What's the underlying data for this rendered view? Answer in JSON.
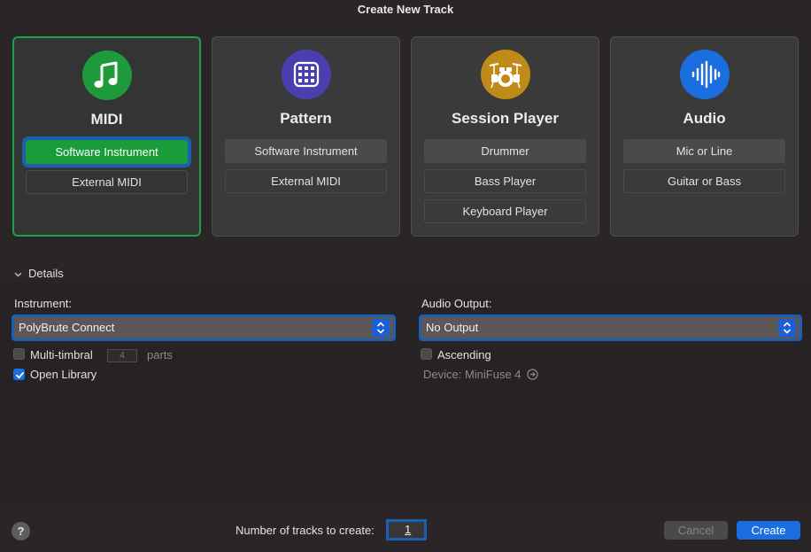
{
  "window": {
    "title": "Create New Track"
  },
  "track_types": [
    {
      "title": "MIDI",
      "icon": "music-note-icon",
      "color": "#1f9a3a",
      "selected": true,
      "options": [
        "Software Instrument",
        "External MIDI"
      ]
    },
    {
      "title": "Pattern",
      "icon": "grid-icon",
      "color": "#4b3fb0",
      "selected": false,
      "options": [
        "Software Instrument",
        "External MIDI"
      ]
    },
    {
      "title": "Session Player",
      "icon": "drum-kit-icon",
      "color": "#c08a18",
      "selected": false,
      "options": [
        "Drummer",
        "Bass Player",
        "Keyboard Player"
      ]
    },
    {
      "title": "Audio",
      "icon": "waveform-icon",
      "color": "#1a6ee0",
      "selected": false,
      "options": [
        "Mic or Line",
        "Guitar or Bass"
      ]
    }
  ],
  "details": {
    "label": "Details",
    "instrument": {
      "label": "Instrument:",
      "value": "PolyBrute Connect",
      "multitimbral_label": "Multi-timbral",
      "multitimbral_checked": false,
      "parts_value": "4",
      "parts_label": "parts",
      "open_library_label": "Open Library",
      "open_library_checked": true
    },
    "audio_output": {
      "label": "Audio Output:",
      "value": "No Output",
      "ascending_label": "Ascending",
      "ascending_checked": false,
      "device_text": "Device: MiniFuse 4"
    }
  },
  "footer": {
    "help": "?",
    "tracks_label": "Number of tracks to create:",
    "tracks_value": "1",
    "cancel_label": "Cancel",
    "create_label": "Create"
  },
  "colors": {
    "accent": "#1a6ee0",
    "focus_ring": "#1a5fb4",
    "selected_green": "#1a9c3a"
  }
}
